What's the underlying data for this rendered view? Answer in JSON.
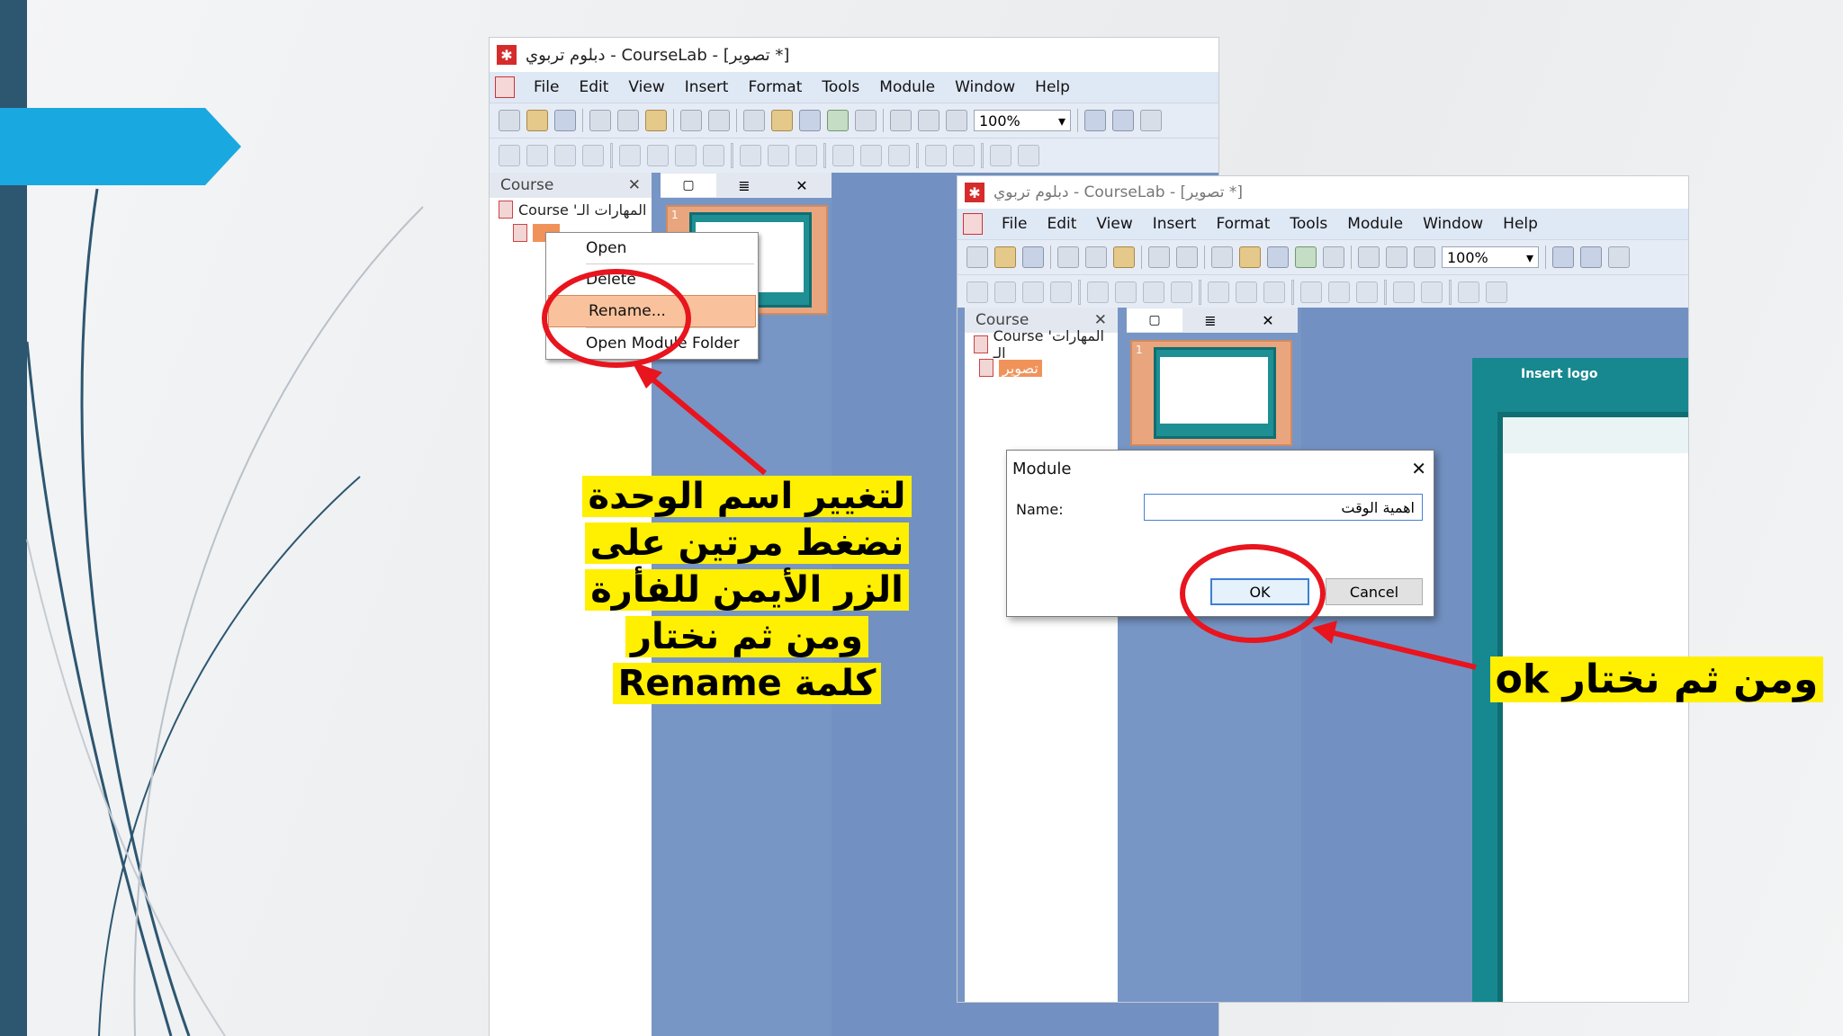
{
  "window1": {
    "title": "دبلوم تربوي - CourseLab - [تصوير *]",
    "menu": [
      "File",
      "Edit",
      "View",
      "Insert",
      "Format",
      "Tools",
      "Module",
      "Window",
      "Help"
    ],
    "zoom": "100%",
    "course_panel": {
      "header": "Course",
      "close": "✕",
      "root": "Course 'المهارات الـ"
    },
    "context_menu": [
      "Open",
      "Delete",
      "Rename...",
      "Open Module Folder"
    ],
    "slide_number": "1"
  },
  "window2": {
    "title": "دبلوم تربوي - CourseLab - [تصوير *]",
    "menu": [
      "File",
      "Edit",
      "View",
      "Insert",
      "Format",
      "Tools",
      "Module",
      "Window",
      "Help"
    ],
    "zoom": "100%",
    "course_panel": {
      "header": "Course",
      "close": "✕",
      "root": "Course 'المهارات الـ",
      "module": "تصوير"
    },
    "slide_number": "1",
    "canvas_text": "Insert logo"
  },
  "dialog": {
    "title": "Module",
    "name_label": "Name:",
    "name_value": "اهمية الوقت",
    "ok": "OK",
    "cancel": "Cancel"
  },
  "annotations": {
    "rename_instructions": [
      "لتغيير اسم الوحدة",
      "نضغط مرتين على",
      "الزر الأيمن  للفأرة",
      "ومن ثم نختار",
      "كلمة Rename"
    ],
    "ok_instruction": "ومن ثم نختار ok"
  },
  "colors": {
    "accent_tab": "#1aa8e0",
    "left_bar": "#2d5670",
    "highlight": "#ffef00",
    "callout": "#e8141e"
  }
}
